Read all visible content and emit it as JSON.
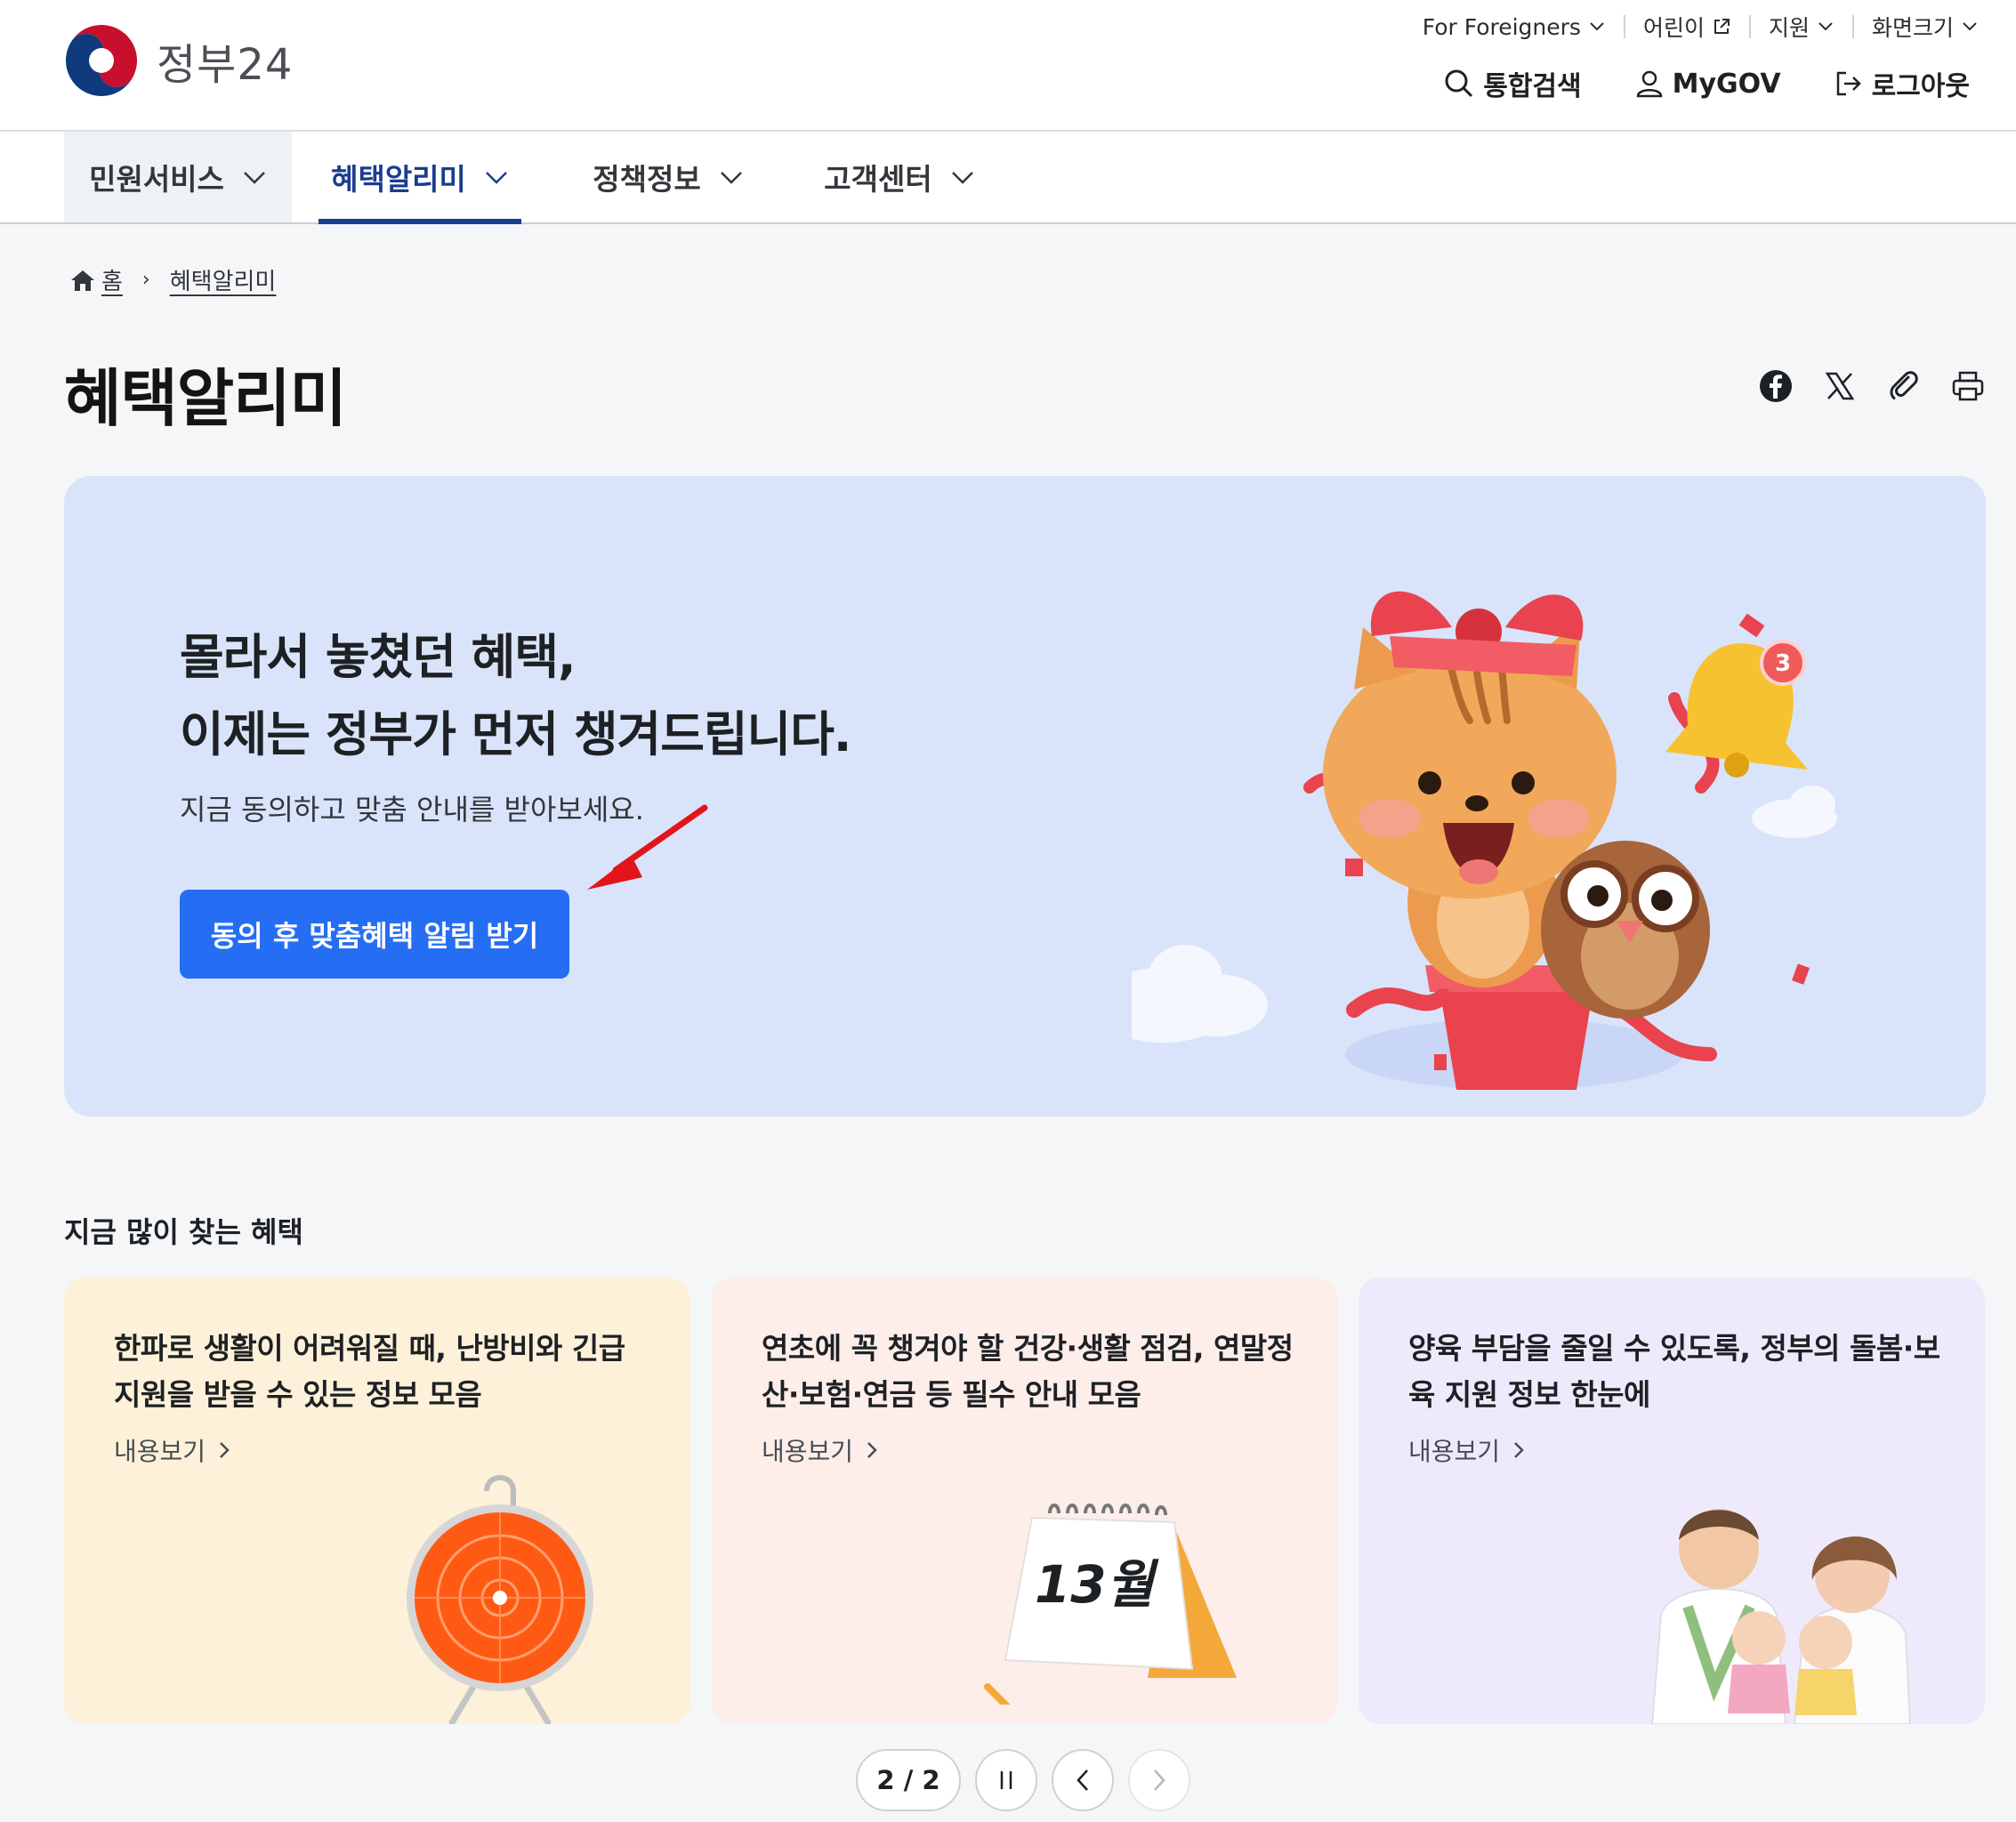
{
  "header": {
    "logo_text": "정부24",
    "util_top": {
      "foreigners": "For Foreigners",
      "kids": "어린이",
      "support": "지원",
      "font_size": "화면크기"
    },
    "util_main": {
      "search": "통합검색",
      "mygov": "MyGOV",
      "logout": "로그아웃"
    }
  },
  "gnb": {
    "items": [
      {
        "label": "민원서비스"
      },
      {
        "label": "혜택알리미"
      },
      {
        "label": "정책정보"
      },
      {
        "label": "고객센터"
      }
    ]
  },
  "breadcrumb": {
    "home": "홈",
    "current": "혜택알리미"
  },
  "page_title": "혜택알리미",
  "share_icons": [
    "facebook-icon",
    "x-icon",
    "link-icon",
    "print-icon"
  ],
  "hero": {
    "headline_1": "몰라서 놓쳤던 혜택,",
    "headline_2": "이제는 정부가 먼저 챙겨드립니다.",
    "subtext": "지금 동의하고 맞춤 안내를 받아보세요.",
    "cta_label": "동의 후 맞춤혜택 알림 받기",
    "bell_badge": "3"
  },
  "popular": {
    "title": "지금 많이 찾는 혜택",
    "cards": [
      {
        "title": "한파로 생활이 어려워질 때, 난방비와 긴급 지원을 받을 수 있는 정보 모음",
        "more": "내용보기"
      },
      {
        "title": "연초에 꼭 챙겨야 할 건강·생활 점검, 연말정산·보험·연금 등 필수 안내 모음",
        "more": "내용보기",
        "calendar": "13월"
      },
      {
        "title": "양육 부담을 줄일 수 있도록, 정부의 돌봄·보육 지원 정보 한눈에",
        "more": "내용보기"
      }
    ]
  },
  "pager": {
    "count": "2 / 2"
  },
  "colors": {
    "brand_navy": "#1b3d8f",
    "cta_blue": "#256ef4",
    "hero_bg": "#d9e4fb",
    "card_yellow": "#fdf1d9",
    "card_pink": "#fdeeea",
    "card_purple": "#efeafb"
  }
}
